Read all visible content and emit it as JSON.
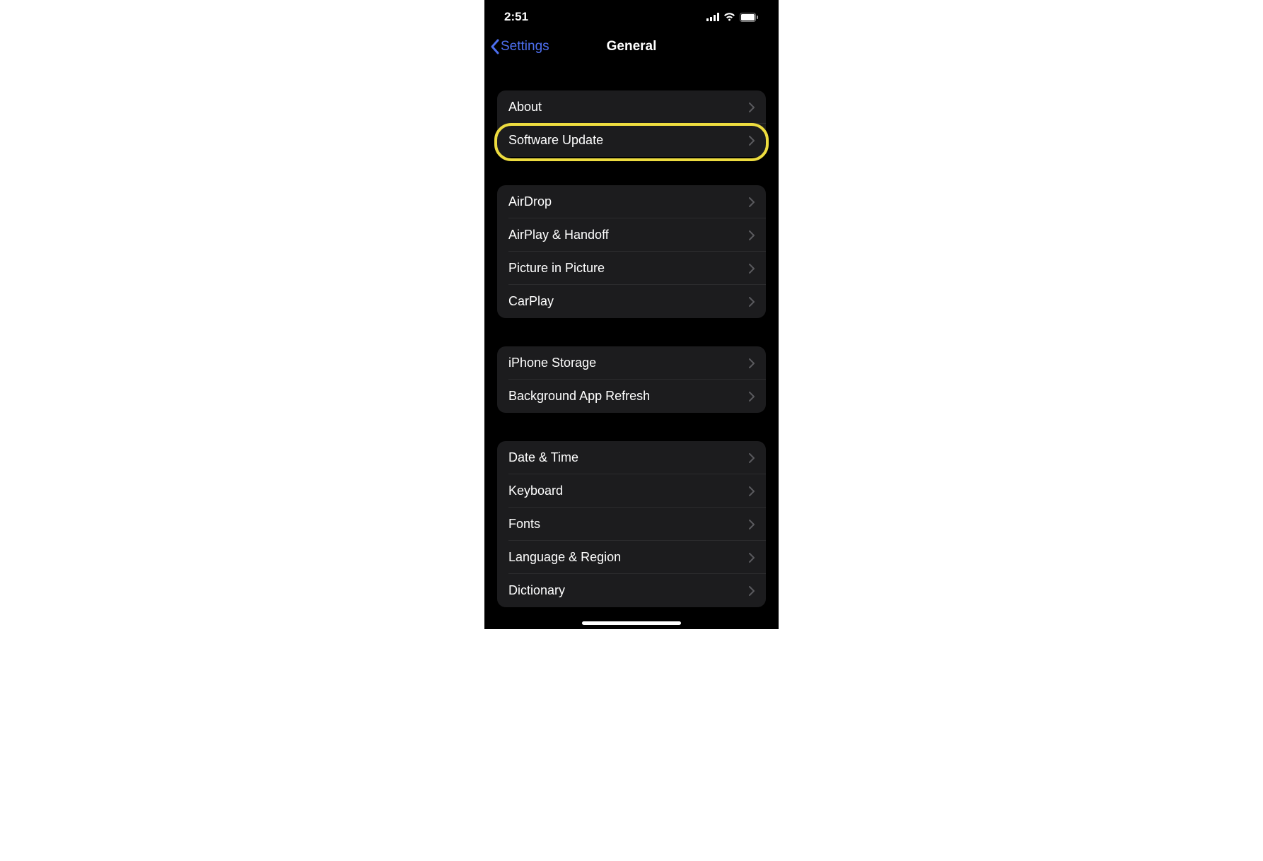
{
  "status_bar": {
    "time": "2:51"
  },
  "nav": {
    "back_label": "Settings",
    "title": "General"
  },
  "groups": [
    {
      "items": [
        {
          "label": "About",
          "highlighted": false
        },
        {
          "label": "Software Update",
          "highlighted": true
        }
      ]
    },
    {
      "items": [
        {
          "label": "AirDrop",
          "highlighted": false
        },
        {
          "label": "AirPlay & Handoff",
          "highlighted": false
        },
        {
          "label": "Picture in Picture",
          "highlighted": false
        },
        {
          "label": "CarPlay",
          "highlighted": false
        }
      ]
    },
    {
      "items": [
        {
          "label": "iPhone Storage",
          "highlighted": false
        },
        {
          "label": "Background App Refresh",
          "highlighted": false
        }
      ]
    },
    {
      "items": [
        {
          "label": "Date & Time",
          "highlighted": false
        },
        {
          "label": "Keyboard",
          "highlighted": false
        },
        {
          "label": "Fonts",
          "highlighted": false
        },
        {
          "label": "Language & Region",
          "highlighted": false
        },
        {
          "label": "Dictionary",
          "highlighted": false
        }
      ]
    }
  ],
  "colors": {
    "accent": "#4d6ff0",
    "highlight": "#eddc3f",
    "group_bg": "#1c1c1e"
  }
}
